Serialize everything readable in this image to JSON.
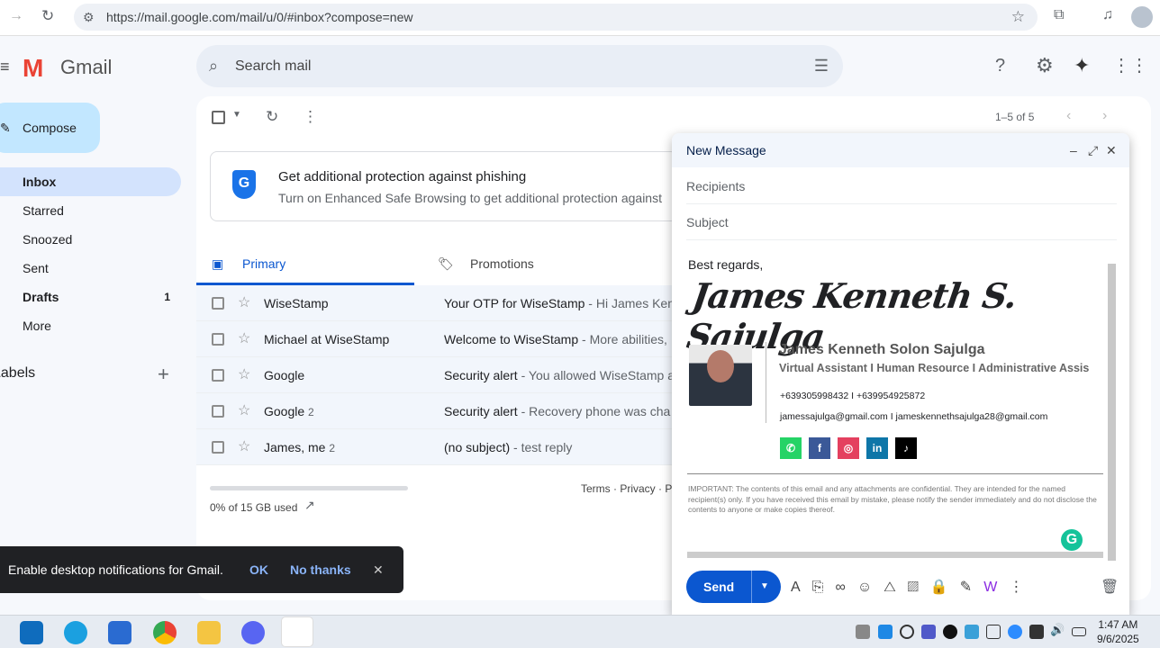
{
  "browser": {
    "url": "https://mail.google.com/mail/u/0/#inbox?compose=new"
  },
  "header": {
    "app_name": "Gmail",
    "search_placeholder": "Search mail"
  },
  "sidebar": {
    "compose": "Compose",
    "items": [
      {
        "label": "Inbox",
        "count": ""
      },
      {
        "label": "Starred",
        "count": ""
      },
      {
        "label": "Snoozed",
        "count": ""
      },
      {
        "label": "Sent",
        "count": ""
      },
      {
        "label": "Drafts",
        "count": "1"
      },
      {
        "label": "More",
        "count": ""
      }
    ],
    "labels_heading": "Labels"
  },
  "toolbar": {
    "pagination": "1–5 of 5"
  },
  "banner": {
    "title": "Get additional protection against phishing",
    "text": "Turn on Enhanced Safe Browsing to get additional protection against"
  },
  "tabs": [
    {
      "label": "Primary"
    },
    {
      "label": "Promotions"
    }
  ],
  "emails": [
    {
      "from": "WiseStamp",
      "count": "",
      "subject": "Your OTP for WiseStamp",
      "snippet": " - Hi James Ken"
    },
    {
      "from": "Michael at WiseStamp",
      "count": "",
      "subject": "Welcome to WiseStamp",
      "snippet": " - More abilities,"
    },
    {
      "from": "Google",
      "count": "",
      "subject": "Security alert",
      "snippet": " - You allowed WiseStamp a"
    },
    {
      "from": "Google",
      "count": "2",
      "subject": "Security alert",
      "snippet": " - Recovery phone was cha"
    },
    {
      "from": "James, me",
      "count": "2",
      "subject": "(no subject)",
      "snippet": " - test reply"
    }
  ],
  "footer": {
    "storage": "0% of 15 GB used",
    "storage_fraction": 0,
    "links": "Terms · Privacy · Pr"
  },
  "compose": {
    "title": "New Message",
    "recipients_placeholder": "Recipients",
    "subject_placeholder": "Subject",
    "greeting": "Best regards,",
    "signature_script": "James Kenneth S. Sajulga",
    "name": "James Kenneth Solon Sajulga",
    "role": "Virtual Assistant I Human Resource I Administrative Assis",
    "phones": "+639305998432 I +639954925872",
    "emails": "jamessajulga@gmail.com I jameskennethsajulga28@gmail.com",
    "social": [
      {
        "name": "whatsapp",
        "color": "#25d366",
        "glyph": "✆"
      },
      {
        "name": "facebook",
        "color": "#3b5998",
        "glyph": "f"
      },
      {
        "name": "instagram",
        "color": "#e4405f",
        "glyph": "◎"
      },
      {
        "name": "linkedin",
        "color": "#0e76a8",
        "glyph": "in"
      },
      {
        "name": "tiktok",
        "color": "#000000",
        "glyph": "♪"
      }
    ],
    "disclaimer": "IMPORTANT: The contents of this email and any attachments are confidential. They are intended for the named recipient(s) only. If you have received this email by mistake, please notify the sender immediately and do not disclose the contents to anyone or make copies thereof.",
    "send": "Send"
  },
  "toast": {
    "text": "Enable desktop notifications for Gmail.",
    "ok": "OK",
    "no": "No thanks"
  },
  "taskbar": {
    "time": "1:47 AM",
    "date": "9/6/2025"
  },
  "colors": {
    "accent": "#0b57d0",
    "selected_nav": "#d3e3fd"
  }
}
